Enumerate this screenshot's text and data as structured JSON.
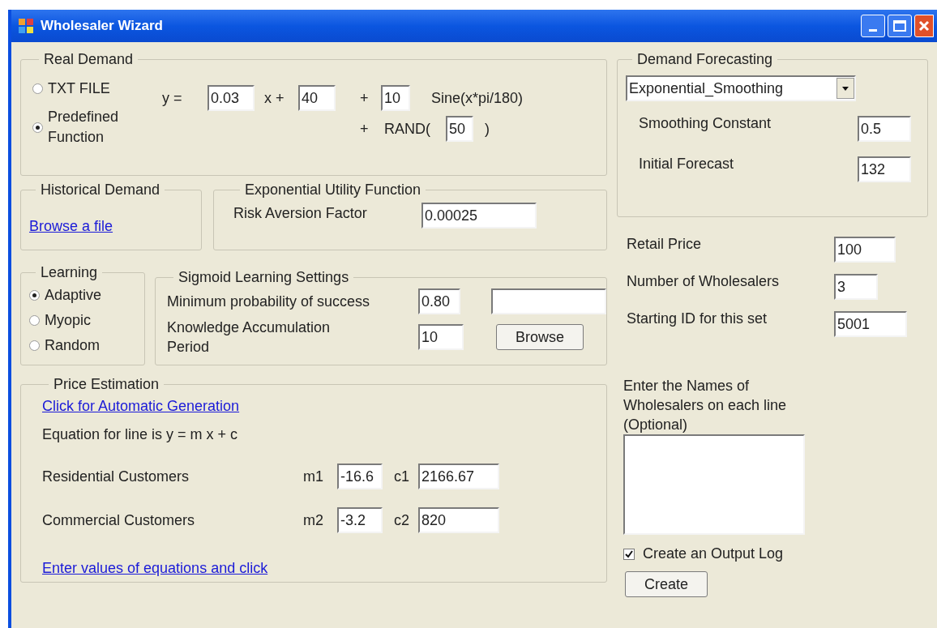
{
  "window": {
    "title": "Wholesaler Wizard"
  },
  "real_demand": {
    "title": "Real Demand",
    "options": [
      {
        "label": "TXT FILE",
        "selected": false
      },
      {
        "label": "Predefined Function",
        "selected": true
      }
    ],
    "y_label": "y =",
    "slope": "0.03",
    "x_label": "x +",
    "intercept": "40",
    "plus_1": "+",
    "amplitude": "10",
    "sine_label": "Sine(x*pi/180)",
    "plus_2": "+",
    "rand_label": "RAND(",
    "rand_value": "50",
    "rand_close": ")"
  },
  "historical_demand": {
    "title": "Historical Demand",
    "link": "Browse a file"
  },
  "utility": {
    "title": "Exponential Utility Function",
    "label": "Risk Aversion Factor",
    "value": "0.00025"
  },
  "learning": {
    "title": "Learning",
    "options": [
      {
        "label": "Adaptive",
        "selected": true
      },
      {
        "label": "Myopic",
        "selected": false
      },
      {
        "label": "Random",
        "selected": false
      }
    ]
  },
  "sigmoid": {
    "title": "Sigmoid Learning Settings",
    "min_label": "Minimum probability of success",
    "min_value": "0.80",
    "period_label": "Knowledge Accumulation Period",
    "period_value": "10",
    "browse_button": "Browse"
  },
  "price_estimation": {
    "title": "Price Estimation",
    "auto_link": "Click for Automatic Generation",
    "equation": "Equation for line is y = m x + c",
    "rows": [
      {
        "label": "Residential Customers",
        "m_label": "m1",
        "m_value": "-16.6",
        "c_label": "c1",
        "c_value": "2166.67"
      },
      {
        "label": "Commercial Customers",
        "m_label": "m2",
        "m_value": "-3.2",
        "c_label": "c2",
        "c_value": "820"
      }
    ],
    "enter_link": "Enter values of equations and click"
  },
  "forecasting": {
    "title": "Demand Forecasting",
    "method": "Exponential_Smoothing",
    "fields": [
      {
        "label": "Smoothing Constant",
        "value": "0.5"
      },
      {
        "label": "Initial Forecast",
        "value": "132"
      }
    ]
  },
  "settings": [
    {
      "label": "Retail Price",
      "value": "100"
    },
    {
      "label": "Number of Wholesalers",
      "value": "3"
    },
    {
      "label": "Starting ID for this set",
      "value": "5001"
    }
  ],
  "names": {
    "label": "Enter the Names of Wholesalers on each line (Optional)"
  },
  "output_log": {
    "label": "Create an Output Log",
    "checked": true
  },
  "create_button": "Create"
}
